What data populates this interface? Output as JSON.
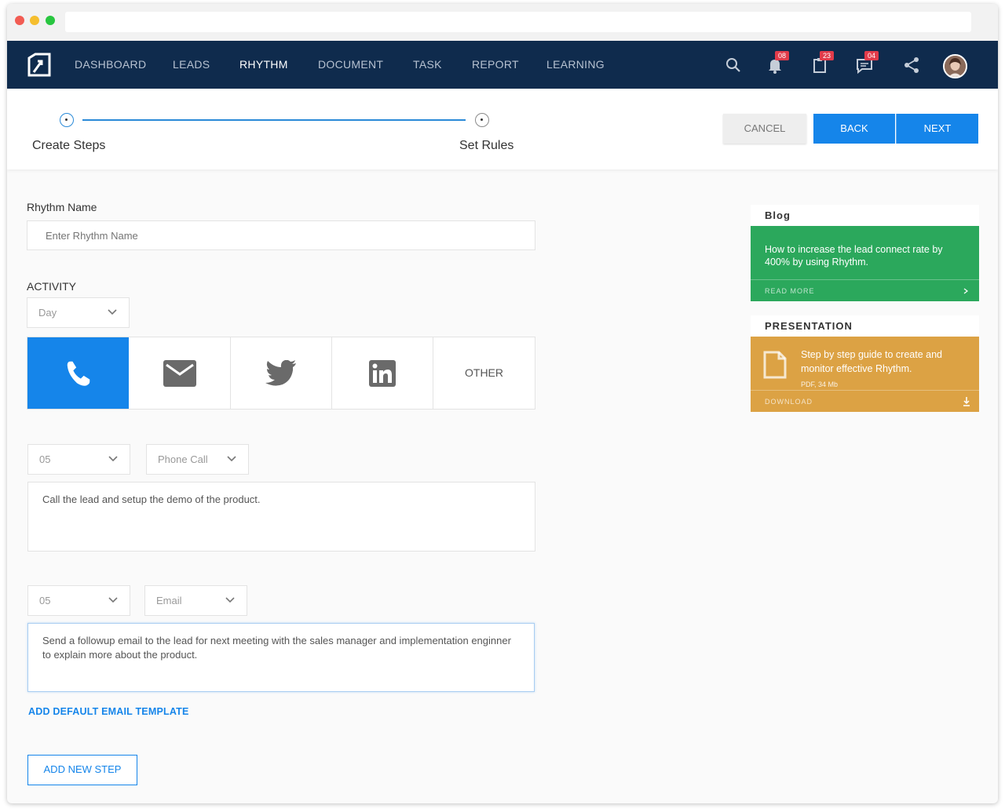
{
  "nav": {
    "items": [
      {
        "label": "DASHBOARD",
        "active": false
      },
      {
        "label": "LEADS",
        "active": false
      },
      {
        "label": "RHYTHM",
        "active": true
      },
      {
        "label": "DOCUMENT",
        "active": false
      },
      {
        "label": "TASK",
        "active": false
      },
      {
        "label": "REPORT",
        "active": false
      },
      {
        "label": "LEARNING",
        "active": false
      }
    ],
    "badges": {
      "notifications": "08",
      "tasks": "23",
      "messages": "04"
    },
    "icons": [
      "search-icon",
      "bell-icon",
      "clipboard-icon",
      "chat-icon",
      "share-icon"
    ]
  },
  "steps": {
    "items": [
      {
        "label": "Create Steps",
        "state": "active"
      },
      {
        "label": "Set Rules",
        "state": "inactive"
      }
    ],
    "cancel_label": "CANCEL",
    "back_label": "BACK",
    "next_label": "NEXT"
  },
  "form": {
    "rhythm_name_label": "Rhythm Name",
    "rhythm_name_placeholder": "Enter Rhythm Name",
    "activity_label": "ACTIVITY",
    "day_select": "Day",
    "activity_types": [
      "phone-icon",
      "email-icon",
      "twitter-icon",
      "linkedin-icon"
    ],
    "activity_other": "OTHER",
    "selected_activity": "phone"
  },
  "tasks": [
    {
      "day": "05",
      "type": "Phone Call",
      "description": "Call the lead and setup the demo of the product."
    },
    {
      "day": "05",
      "type": "Email",
      "description": "Send a followup email to the lead for next meeting with the sales manager and implementation enginner to explain more about the product."
    }
  ],
  "add_email_template_label": "ADD DEFAULT EMAIL TEMPLATE",
  "add_step_label": "ADD NEW STEP",
  "sidebar": {
    "blog": {
      "heading": "Blog",
      "text": "How to increase the lead connect rate by 400% by using Rhythm.",
      "action": "READ MORE",
      "color": "#2ba85c"
    },
    "presentation": {
      "heading": "PRESENTATION",
      "text": "Step by step guide to create and monitor effective Rhythm.",
      "meta": "PDF, 34 Mb",
      "action": "DOWNLOAD",
      "color": "#dca244"
    }
  },
  "colors": {
    "navbar": "#0f2b4d",
    "accent": "#1585ea",
    "badge": "#e23b4a"
  }
}
